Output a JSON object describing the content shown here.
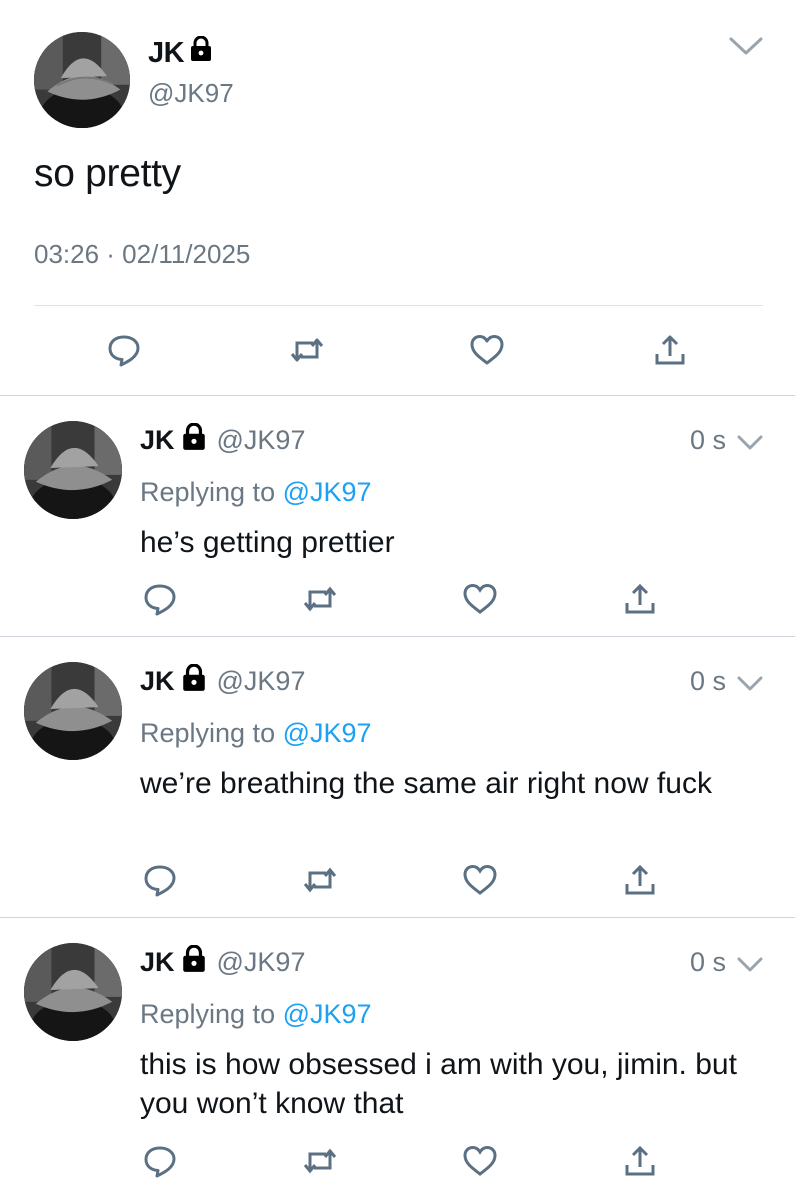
{
  "main_tweet": {
    "name": "JK",
    "handle": "@JK97",
    "text": "so pretty",
    "timestamp": "03:26 · 02/11/2025",
    "icons": {
      "lock": "lock-icon",
      "menu": "chevron-down-icon",
      "reply": "reply-icon",
      "retweet": "retweet-icon",
      "like": "heart-icon",
      "share": "share-icon"
    }
  },
  "replies": [
    {
      "name": "JK",
      "handle": "@JK97",
      "time": "0 s",
      "replying_prefix": "Replying to",
      "replying_to": "@JK97",
      "text": "he’s getting prettier"
    },
    {
      "name": "JK",
      "handle": "@JK97",
      "time": "0 s",
      "replying_prefix": "Replying to",
      "replying_to": "@JK97",
      "text": "we’re breathing the same air right now fuck"
    },
    {
      "name": "JK",
      "handle": "@JK97",
      "time": "0 s",
      "replying_prefix": "Replying to",
      "replying_to": "@JK97",
      "text": "this is how obsessed i am with you, jimin. but you won’t know that"
    }
  ],
  "colors": {
    "text": "#0f1419",
    "secondary": "#6b7884",
    "link": "#1da1f2",
    "divider": "#cfd5da",
    "icon": "#5b7083"
  }
}
